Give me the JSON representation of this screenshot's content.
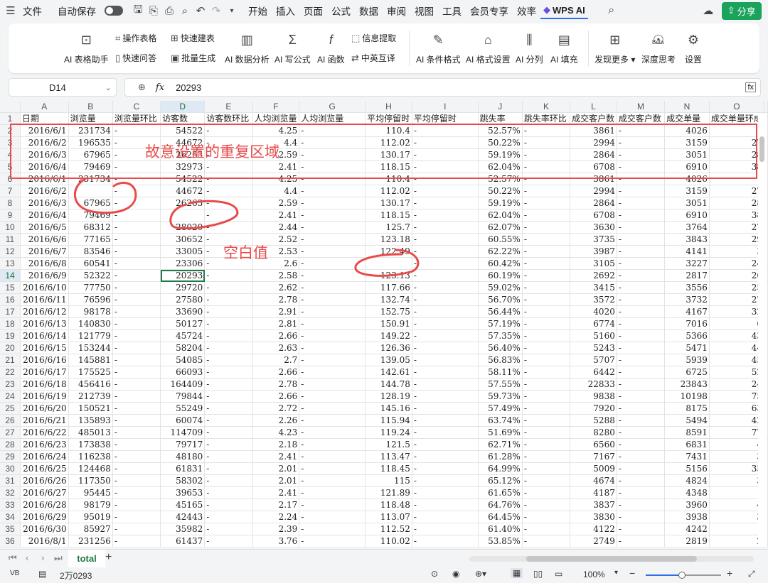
{
  "titlebar": {
    "file_label": "文件",
    "autosave_label": "自动保存",
    "menus": [
      "开始",
      "插入",
      "页面",
      "公式",
      "数据",
      "审阅",
      "视图",
      "工具",
      "会员专享",
      "效率"
    ],
    "wps_ai_label": "WPS AI",
    "share_label": "分享"
  },
  "ribbon": {
    "ai_table_helper": "AI 表格助手",
    "operate_table": "操作表格",
    "quick_build": "快速建表",
    "quick_qa": "快速问答",
    "batch_generate": "批量生成",
    "ai_data_analysis": "AI 数据分析",
    "ai_write_formula": "AI 写公式",
    "info_extract": "信息提取",
    "ai_function": "AI 函数",
    "cn_en_translate": "中英互译",
    "ai_conditional_format": "AI 条件格式",
    "ai_format_settings": "AI 格式设置",
    "ai_split_column": "AI 分列",
    "ai_fill": "AI 填充",
    "discover_more": "发现更多",
    "deep_thinking": "深度思考",
    "beta_badge": "Beta",
    "settings": "设置"
  },
  "formula_bar": {
    "cell_ref": "D14",
    "fx_label": "fx",
    "value": "20293"
  },
  "sheet": {
    "columns": [
      "A",
      "B",
      "C",
      "D",
      "E",
      "F",
      "G",
      "H",
      "I",
      "J",
      "K",
      "L",
      "M",
      "N",
      "O"
    ],
    "header_row": [
      "日期",
      "浏览量",
      "浏览量环比",
      "访客数",
      "访客数环比",
      "人均浏览量",
      "人均浏览量",
      "平均停留时",
      "平均停留时",
      "跳失率",
      "跳失率环比",
      "成交客户数",
      "成交客户数",
      "成交单量",
      "成交单量环成"
    ],
    "rows": [
      [
        "2016/6/1",
        "231734",
        "-",
        "54522",
        "-",
        "4.25",
        "-",
        "110.4",
        "-",
        "52.57%",
        "-",
        "3861",
        "-",
        "4026",
        "-"
      ],
      [
        "2016/6/2",
        "196535",
        "-",
        "44672",
        "-",
        "4.4",
        "-",
        "112.02",
        "-",
        "50.22%",
        "-",
        "2994",
        "-",
        "3159",
        "27"
      ],
      [
        "2016/6/3",
        "67965",
        "-",
        "26263",
        "-",
        "2.59",
        "-",
        "130.17",
        "-",
        "59.19%",
        "-",
        "2864",
        "-",
        "3051",
        "28"
      ],
      [
        "2016/6/4",
        "79469",
        "-",
        "32973",
        "-",
        "2.41",
        "-",
        "118.15",
        "-",
        "62.04%",
        "-",
        "6708",
        "-",
        "6910",
        "38"
      ],
      [
        "2016/6/1",
        "231734",
        "-",
        "54522",
        "-",
        "4.25",
        "-",
        "110.4",
        "-",
        "52.57%",
        "-",
        "3861",
        "-",
        "4026",
        "-"
      ],
      [
        "2016/6/2",
        "",
        "-",
        "44672",
        "-",
        "4.4",
        "-",
        "112.02",
        "-",
        "50.22%",
        "-",
        "2994",
        "-",
        "3159",
        "27"
      ],
      [
        "2016/6/3",
        "67965",
        "-",
        "26263",
        "-",
        "2.59",
        "-",
        "130.17",
        "-",
        "59.19%",
        "-",
        "2864",
        "-",
        "3051",
        "28"
      ],
      [
        "2016/6/4",
        "79469",
        "-",
        "",
        "-",
        "2.41",
        "-",
        "118.15",
        "-",
        "62.04%",
        "-",
        "6708",
        "-",
        "6910",
        "38"
      ],
      [
        "2016/6/5",
        "68312",
        "-",
        "28020",
        "-",
        "2.44",
        "-",
        "125.7",
        "-",
        "62.07%",
        "-",
        "3630",
        "-",
        "3764",
        "27"
      ],
      [
        "2016/6/6",
        "77165",
        "-",
        "30652",
        "-",
        "2.52",
        "-",
        "123.18",
        "-",
        "60.55%",
        "-",
        "3735",
        "-",
        "3843",
        "29"
      ],
      [
        "2016/6/7",
        "83546",
        "-",
        "33005",
        "-",
        "2.53",
        "-",
        "122.49",
        "-",
        "62.22%",
        "-",
        "3987",
        "-",
        "4141",
        "3"
      ],
      [
        "2016/6/8",
        "60541",
        "-",
        "23306",
        "-",
        "2.6",
        "-",
        "",
        "-",
        "60.42%",
        "-",
        "3105",
        "-",
        "3227",
        "24"
      ],
      [
        "2016/6/9",
        "52322",
        "-",
        "20293",
        "-",
        "2.58",
        "-",
        "123.13",
        "-",
        "60.19%",
        "-",
        "2692",
        "-",
        "2817",
        "20"
      ],
      [
        "2016/6/10",
        "77750",
        "-",
        "29720",
        "-",
        "2.62",
        "-",
        "117.66",
        "-",
        "59.02%",
        "-",
        "3415",
        "-",
        "3556",
        "25"
      ],
      [
        "2016/6/11",
        "76596",
        "-",
        "27580",
        "-",
        "2.78",
        "-",
        "132.74",
        "-",
        "56.70%",
        "-",
        "3572",
        "-",
        "3732",
        "27"
      ],
      [
        "2016/6/12",
        "98178",
        "-",
        "33690",
        "-",
        "2.91",
        "-",
        "152.75",
        "-",
        "56.44%",
        "-",
        "4020",
        "-",
        "4167",
        "32"
      ],
      [
        "2016/6/13",
        "140830",
        "-",
        "50127",
        "-",
        "2.81",
        "-",
        "150.91",
        "-",
        "57.19%",
        "-",
        "6774",
        "-",
        "7016",
        "6"
      ],
      [
        "2016/6/14",
        "121779",
        "-",
        "45724",
        "-",
        "2.66",
        "-",
        "149.22",
        "-",
        "57.35%",
        "-",
        "5160",
        "-",
        "5366",
        "43"
      ],
      [
        "2016/6/15",
        "153244",
        "-",
        "58204",
        "-",
        "2.63",
        "-",
        "126.36",
        "-",
        "56.40%",
        "-",
        "5243",
        "-",
        "5471",
        "44"
      ],
      [
        "2016/6/16",
        "145881",
        "-",
        "54085",
        "-",
        "2.7",
        "-",
        "139.05",
        "-",
        "56.83%",
        "-",
        "5707",
        "-",
        "5939",
        "45"
      ],
      [
        "2016/6/17",
        "175525",
        "-",
        "66093",
        "-",
        "2.66",
        "-",
        "142.61",
        "-",
        "58.11%",
        "-",
        "6442",
        "-",
        "6725",
        "52"
      ],
      [
        "2016/6/18",
        "456416",
        "-",
        "164409",
        "-",
        "2.78",
        "-",
        "144.78",
        "-",
        "57.55%",
        "-",
        "22833",
        "-",
        "23843",
        "24"
      ],
      [
        "2016/6/19",
        "212739",
        "-",
        "79844",
        "-",
        "2.66",
        "-",
        "128.19",
        "-",
        "59.73%",
        "-",
        "9838",
        "-",
        "10198",
        "75"
      ],
      [
        "2016/6/20",
        "150521",
        "-",
        "55249",
        "-",
        "2.72",
        "-",
        "145.16",
        "-",
        "57.49%",
        "-",
        "7920",
        "-",
        "8175",
        "63"
      ],
      [
        "2016/6/21",
        "135893",
        "-",
        "60074",
        "-",
        "2.26",
        "-",
        "115.94",
        "-",
        "63.74%",
        "-",
        "5288",
        "-",
        "5494",
        "42"
      ],
      [
        "2016/6/22",
        "485013",
        "-",
        "114709",
        "-",
        "4.23",
        "-",
        "119.24",
        "-",
        "51.69%",
        "-",
        "8280",
        "-",
        "8591",
        "77"
      ],
      [
        "2016/6/23",
        "173838",
        "-",
        "79717",
        "-",
        "2.18",
        "-",
        "121.5",
        "-",
        "62.71%",
        "-",
        "6560",
        "-",
        "6831",
        "4"
      ],
      [
        "2016/6/24",
        "116238",
        "-",
        "48180",
        "-",
        "2.41",
        "-",
        "113.47",
        "-",
        "61.28%",
        "-",
        "7167",
        "-",
        "7431",
        "3"
      ],
      [
        "2016/6/25",
        "124468",
        "-",
        "61831",
        "-",
        "2.01",
        "-",
        "118.45",
        "-",
        "64.99%",
        "-",
        "5009",
        "-",
        "5156",
        "35"
      ],
      [
        "2016/6/26",
        "117350",
        "-",
        "58302",
        "-",
        "2.01",
        "-",
        "115",
        "-",
        "65.12%",
        "-",
        "4674",
        "-",
        "4824",
        "3"
      ],
      [
        "2016/6/27",
        "95445",
        "-",
        "39653",
        "-",
        "2.41",
        "-",
        "121.89",
        "-",
        "61.65%",
        "-",
        "4187",
        "-",
        "4348",
        ""
      ],
      [
        "2016/6/28",
        "98179",
        "-",
        "45165",
        "-",
        "2.17",
        "-",
        "118.48",
        "-",
        "64.76%",
        "-",
        "3837",
        "-",
        "3960",
        "4"
      ],
      [
        "2016/6/29",
        "95019",
        "-",
        "42443",
        "-",
        "2.24",
        "-",
        "113.07",
        "-",
        "64.45%",
        "-",
        "3830",
        "-",
        "3938",
        "3"
      ],
      [
        "2016/6/30",
        "85927",
        "-",
        "35982",
        "-",
        "2.39",
        "-",
        "112.52",
        "-",
        "61.40%",
        "-",
        "4122",
        "-",
        "4242",
        "-"
      ],
      [
        "2016/8/1",
        "231256",
        "-",
        "61437",
        "-",
        "3.76",
        "-",
        "110.02",
        "-",
        "53.85%",
        "-",
        "2749",
        "-",
        "2819",
        "2"
      ]
    ],
    "row_numbers": [
      "1",
      "2",
      "3",
      "4",
      "5",
      "6",
      "7",
      "8",
      "9",
      "10",
      "11",
      "12",
      "13",
      "14",
      "15",
      "16",
      "17",
      "18",
      "19",
      "20",
      "21",
      "22",
      "23",
      "24",
      "25",
      "26",
      "27",
      "28",
      "29",
      "30",
      "31",
      "32",
      "33",
      "34",
      "35",
      "36"
    ]
  },
  "annotations": {
    "duplicate_region": "故意设置的重复区域",
    "blank_values": "空白值"
  },
  "sheet_tabs": {
    "active_tab": "total"
  },
  "statusbar": {
    "sum_value": "2万0293",
    "zoom": "100%"
  },
  "colors": {
    "accent_green": "#1f7a44",
    "annotation_red": "#e94a4a",
    "share_green": "#1aa35a"
  }
}
